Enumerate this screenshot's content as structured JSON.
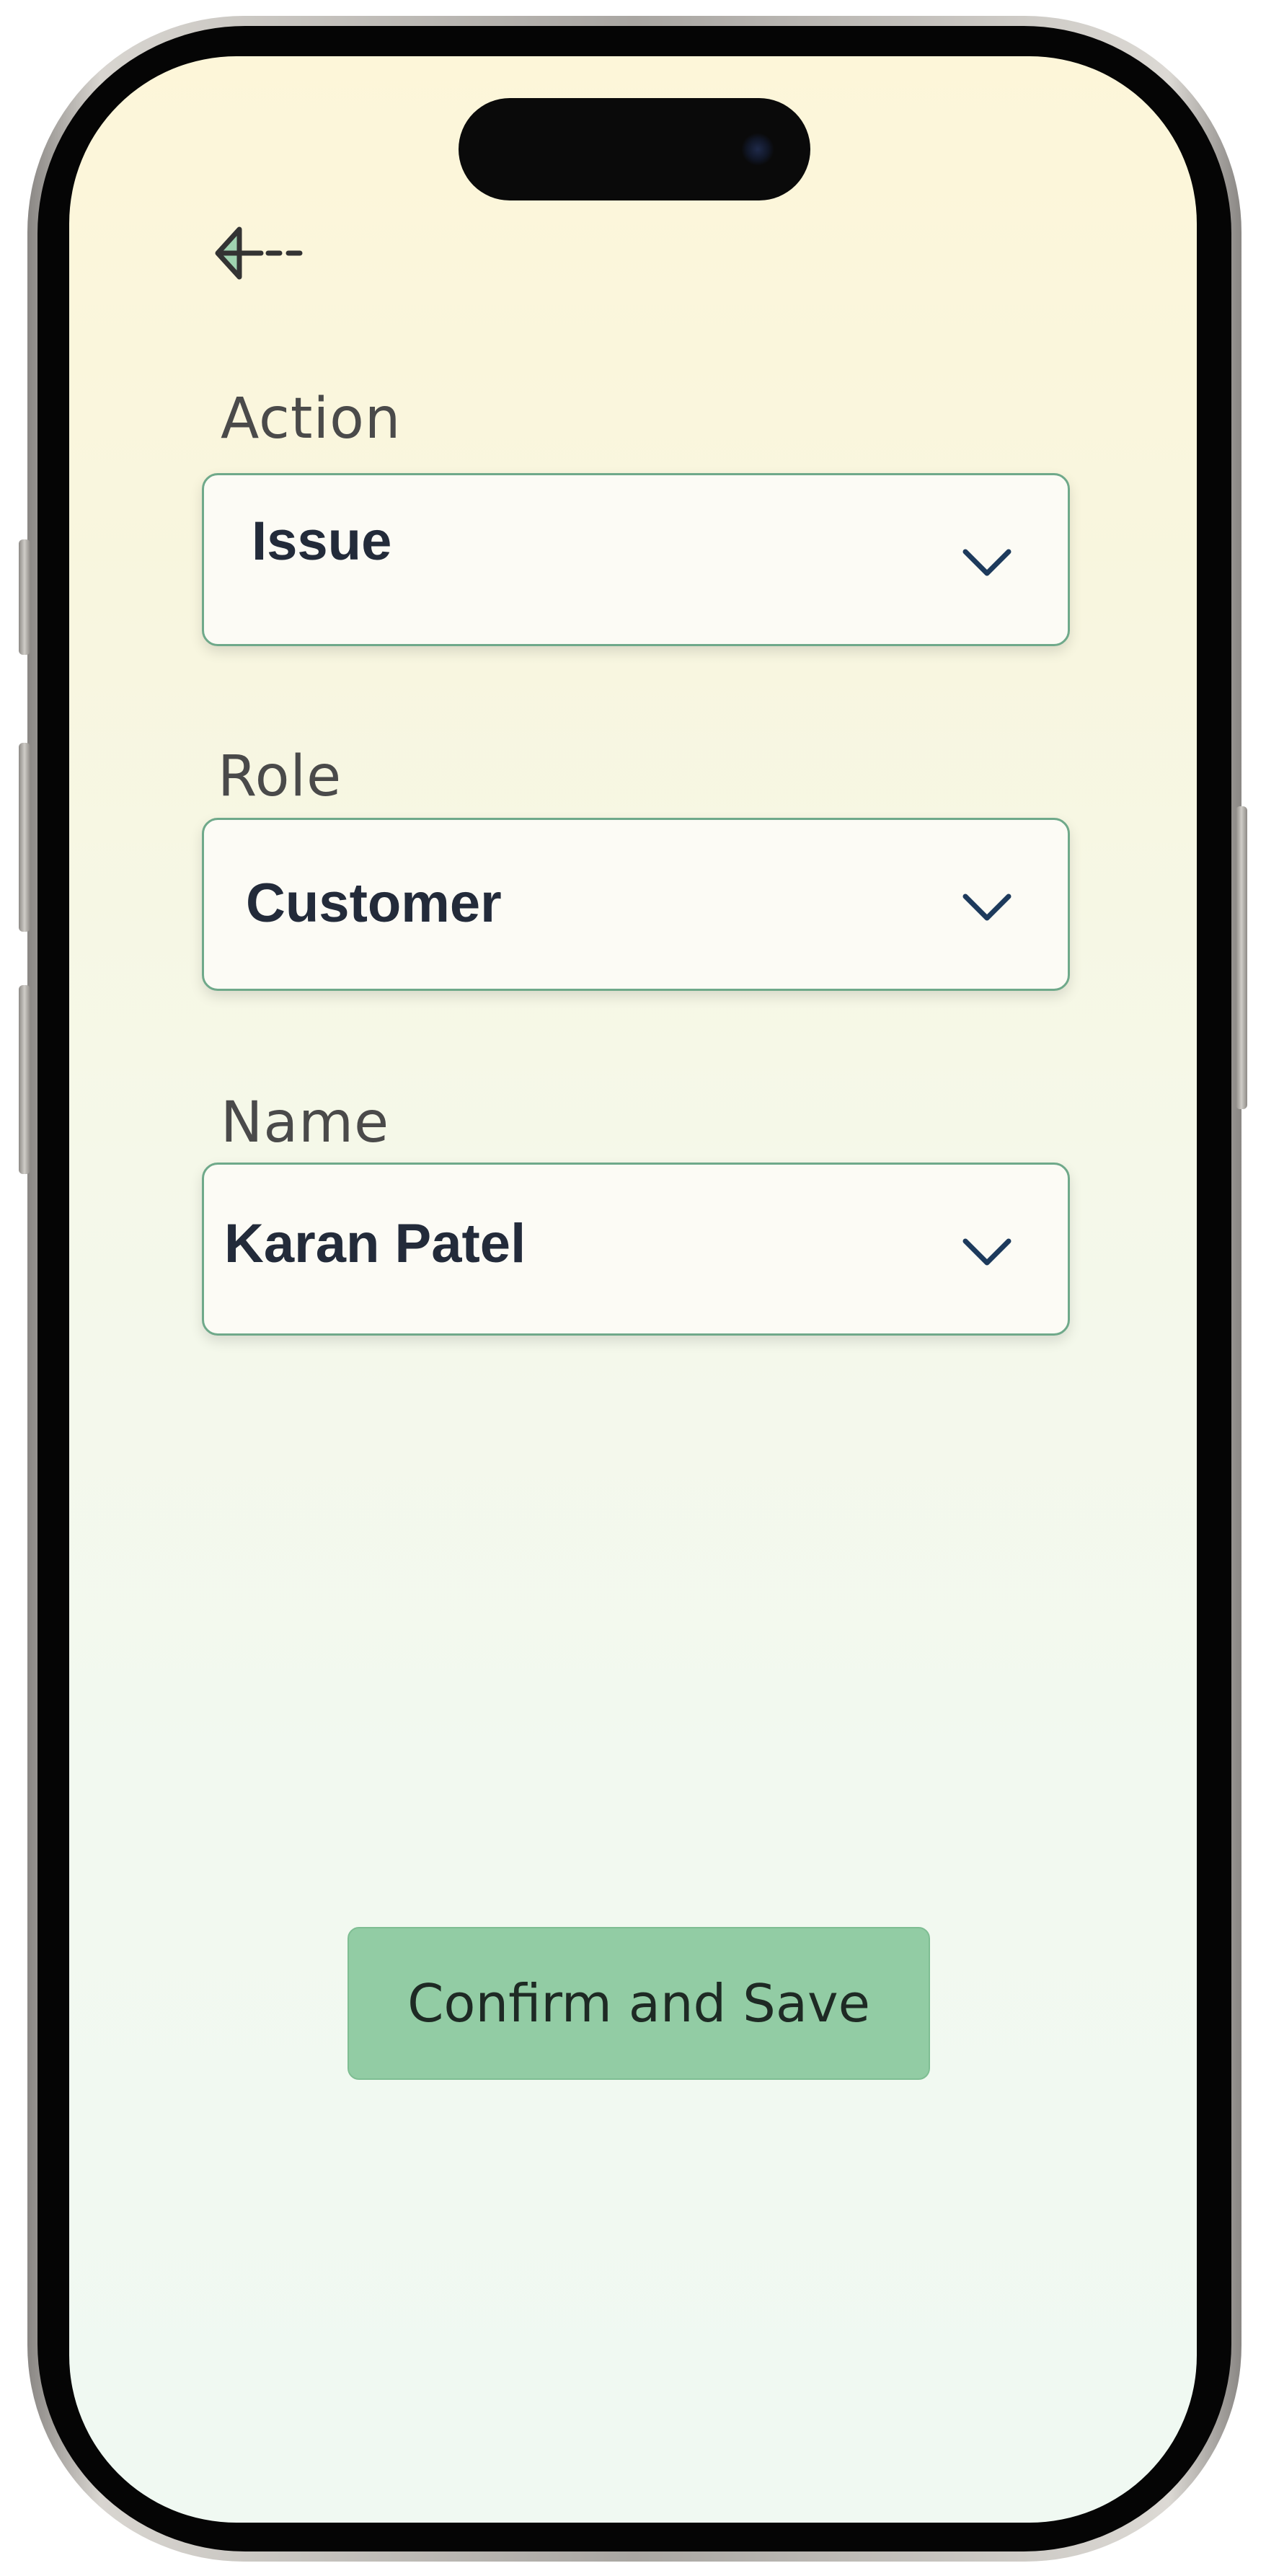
{
  "header": {
    "back_icon": "arrow-left-icon"
  },
  "form": {
    "action": {
      "label": "Action",
      "value": "Issue"
    },
    "role": {
      "label": "Role",
      "value": "Customer"
    },
    "name": {
      "label": "Name",
      "value": "Karan Patel"
    }
  },
  "confirm_label": "Confirm and Save",
  "colors": {
    "accent_border": "#6fa98a",
    "button_fill": "#92cca4",
    "chevron": "#1d3a5c"
  }
}
